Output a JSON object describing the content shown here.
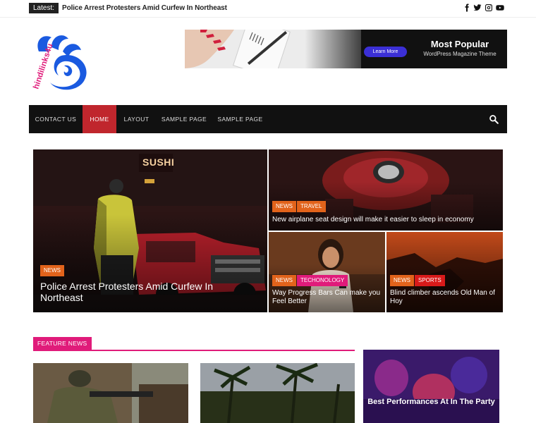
{
  "topbar": {
    "latest_label": "Latest:",
    "latest_headline": "Police Arrest Protesters Amid Curfew In Northeast",
    "social_icons": [
      "facebook-icon",
      "twitter-icon",
      "instagram-icon",
      "youtube-icon"
    ]
  },
  "header": {
    "logo_text": "hindilinks4u",
    "banner": {
      "button_label": "Learn More",
      "title": "Most Popular",
      "subtitle": "WordPress Magazine Theme"
    }
  },
  "nav": {
    "items": [
      {
        "label": "CONTACT US",
        "active": false
      },
      {
        "label": "HOME",
        "active": true
      },
      {
        "label": "LAYOUT",
        "active": false
      },
      {
        "label": "SAMPLE PAGE",
        "active": false
      },
      {
        "label": "SAMPLE PAGE",
        "active": false
      }
    ],
    "search_icon": "search-icon"
  },
  "hero": {
    "main": {
      "sign_text": "SUSHI",
      "tags": [
        "NEWS"
      ],
      "title": "Police Arrest Protesters Amid Curfew In Northeast"
    },
    "top_right": {
      "tags": [
        "NEWS",
        "TRAVEL"
      ],
      "title": "New airplane seat design will make it easier to sleep in economy"
    },
    "bottom_left": {
      "tags": [
        "NEWS",
        "TECHONOLOGY"
      ],
      "title": "Way Progress Bars Can make you Feel Better"
    },
    "bottom_right": {
      "tags": [
        "NEWS",
        "SPORTS"
      ],
      "title": "Blind climber ascends Old Man of Hoy"
    }
  },
  "feature": {
    "section_label": "FEATURE NEWS",
    "side_card_title": "Best Performances At In The Party"
  },
  "colors": {
    "accent_pink": "#e01b7a",
    "nav_active": "#c0262d",
    "tag_orange": "#e2631b",
    "logo_blue": "#1a5ae0"
  }
}
